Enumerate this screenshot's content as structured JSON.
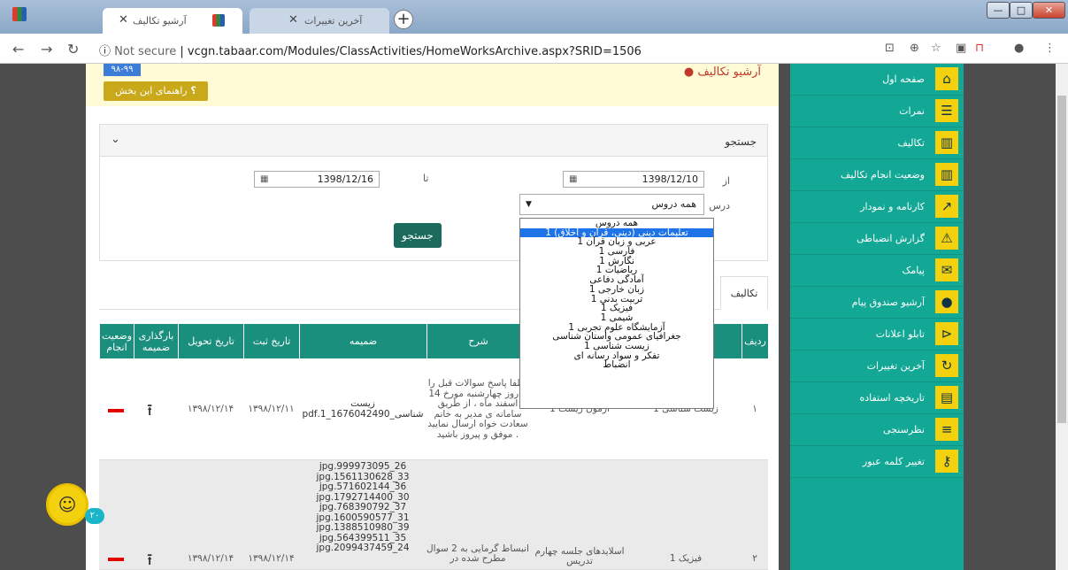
{
  "browser": {
    "tabs": [
      {
        "label": "آرشیو تکالیف",
        "active": true
      },
      {
        "label": "آخرین تغییرات",
        "active": false
      }
    ],
    "url_prefix": "Not secure",
    "url": "vcgn.tabaar.com/Modules/ClassActivities/HomeWorksArchive.aspx?SRID=1506"
  },
  "header": {
    "title": "آرشیو تکالیف",
    "year": "۹۸-۹۹",
    "help": "راهنمای این بخش"
  },
  "search": {
    "title": "جستجو",
    "from_label": "از",
    "to_label": "تا",
    "course_label": "درس",
    "from_date": "1398/12/10",
    "to_date": "1398/12/16",
    "course_selected": "همه دروس",
    "button": "جستجو"
  },
  "dropdown_options": [
    "همه دروس",
    "تعلیمات دینی (دینی، قرآن و اخلاق) 1",
    "عربی و زبان قرآن 1",
    "فارسی 1",
    "نگارش 1",
    "ریاضیات 1",
    "آمادگی دفاعی",
    "زبان خارجی 1",
    "تربیت بدنی 1",
    "فیزیک 1",
    "شیمی 1",
    "آزمایشگاه علوم تجربی 1",
    "جغرافیای عمومی واستان شناسی",
    "زیست شناسی 1",
    "تفکر و سواد رسانه ای",
    "انضباط"
  ],
  "tabs": {
    "homework": "تکالیف"
  },
  "grid": {
    "headers": {
      "row": "ردیف",
      "desc": "شرح",
      "attachment": "ضمیمه",
      "reg_date": "تاریخ ثبت",
      "due_date": "تاریخ تحویل",
      "upload": "بارگذاری ضمیمه",
      "status": "وضعیت انجام"
    },
    "rows": [
      {
        "row": "۱",
        "course": "زیست شناسی 1",
        "title": "ازمون زیست 1",
        "desc": "لطفا پاسخ سوالات قبل را تا روز چهارشنبه مورخ 14 اسفند ماه ، از طریق سامانه ی مدیر به خانم سعادت خواه ارسال نمایید . موفق و پیروز باشید",
        "attachment": "زیست شناسی_1676042490_1.pdf",
        "reg_date": "۱۳۹۸/۱۲/۱۱",
        "due_date": "۱۳۹۸/۱۲/۱۴"
      },
      {
        "row": "۲",
        "course": "فیزیک 1",
        "title": "اسلایدهای جلسه چهارم تدریس",
        "desc": "انبساط گرمایی به 2 سوال مطرح شده در",
        "attachment_list": [
          "jpg.999973095_26",
          "jpg.1561130628_33",
          "jpg.571602144_36",
          "jpg.1792714400_30",
          "jpg.768390792_37",
          "jpg.1600590577_31",
          "jpg.1388510980_39",
          "jpg.564399511_35",
          "jpg.2099437459_24"
        ],
        "reg_date": "۱۳۹۸/۱۲/۱۴",
        "due_date": "۱۳۹۸/۱۲/۱۴"
      }
    ]
  },
  "sidebar": [
    {
      "label": "صفحه اول",
      "icon": "home-icon",
      "glyph": "⌂"
    },
    {
      "label": "نمرات",
      "icon": "list-numbered-icon",
      "glyph": "☰"
    },
    {
      "label": "تکالیف",
      "icon": "book-icon",
      "glyph": "▥"
    },
    {
      "label": "وضعیت انجام تکالیف",
      "icon": "book-open-icon",
      "glyph": "▥"
    },
    {
      "label": "کارنامه و نمودار",
      "icon": "chart-icon",
      "glyph": "↗"
    },
    {
      "label": "گزارش انضباطی",
      "icon": "person-warning-icon",
      "glyph": "⚠"
    },
    {
      "label": "پیامک",
      "icon": "envelope-icon",
      "glyph": "✉"
    },
    {
      "label": "آرشیو صندوق پیام",
      "icon": "chat-icon",
      "glyph": "●"
    },
    {
      "label": "تابلو اعلانات",
      "icon": "megaphone-icon",
      "glyph": "⊳"
    },
    {
      "label": "آخرین تغییرات",
      "icon": "refresh-icon",
      "glyph": "↻"
    },
    {
      "label": "تاریخچه استفاده",
      "icon": "archive-icon",
      "glyph": "▤"
    },
    {
      "label": "نظرسنجی",
      "icon": "survey-icon",
      "glyph": "≡"
    },
    {
      "label": "تغییر کلمه عبور",
      "icon": "key-icon",
      "glyph": "⚷"
    }
  ],
  "chat": {
    "badge": "۲۰"
  }
}
